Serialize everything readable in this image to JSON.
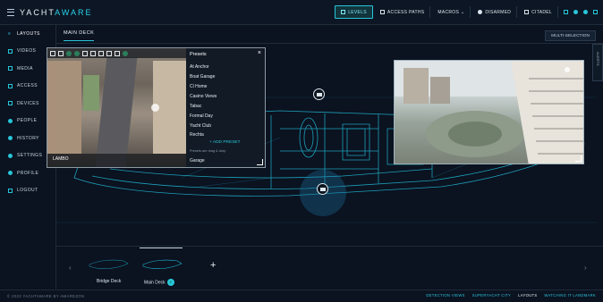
{
  "app": {
    "brand_left": "YACHT",
    "brand_right": "AWARE"
  },
  "topbar": {
    "levels": "LEVELS",
    "access_paths": "ACCESS PATHS",
    "macros": "MACROS",
    "disarmed": "DISARMED",
    "citadel": "CITADEL"
  },
  "sidebar": {
    "items": [
      {
        "label": "LAYOUTS",
        "icon": "layouts-icon"
      },
      {
        "label": "VIDEOS",
        "icon": "video-icon"
      },
      {
        "label": "MEDIA",
        "icon": "media-icon"
      },
      {
        "label": "ACCESS",
        "icon": "access-icon"
      },
      {
        "label": "DEVICES",
        "icon": "devices-icon"
      },
      {
        "label": "PEOPLE",
        "icon": "people-icon"
      },
      {
        "label": "HISTORY",
        "icon": "history-icon"
      },
      {
        "label": "SETTINGS",
        "icon": "settings-icon"
      },
      {
        "label": "PROFILE",
        "icon": "profile-icon"
      },
      {
        "label": "LOGOUT",
        "icon": "logout-icon"
      }
    ]
  },
  "main": {
    "tab": "MAIN DECK",
    "multi_selection": "MULTI-SELECTION"
  },
  "camera1": {
    "label": "LAMBO",
    "presets_title": "Presets",
    "presets": [
      "At Anchor",
      "Boat Garage",
      "Cl Home",
      "Casino Views",
      "Tabac",
      "Formal Day",
      "Yacht Club",
      "Rechta",
      "Garage"
    ],
    "add_preset": "+ ADD PRESET",
    "note": "Presets are drag & drop"
  },
  "side_handle": "ALERTS",
  "decks": {
    "items": [
      {
        "label": "Bridge Deck"
      },
      {
        "label": "Main Deck",
        "badge": "5"
      }
    ]
  },
  "footer": {
    "copyright": "© 2023 YACHTAWARE BY AWAREZON",
    "links": [
      {
        "label": "DETECTION VIEWS",
        "current": false
      },
      {
        "label": "SUPERYACHT CITY",
        "current": false
      },
      {
        "label": "LAYOUTS",
        "current": true
      },
      {
        "label": "WATCHING IT LANDMARK",
        "current": false
      }
    ]
  },
  "colors": {
    "accent": "#28c6da",
    "background": "#0b1220",
    "panel": "#121a25"
  }
}
